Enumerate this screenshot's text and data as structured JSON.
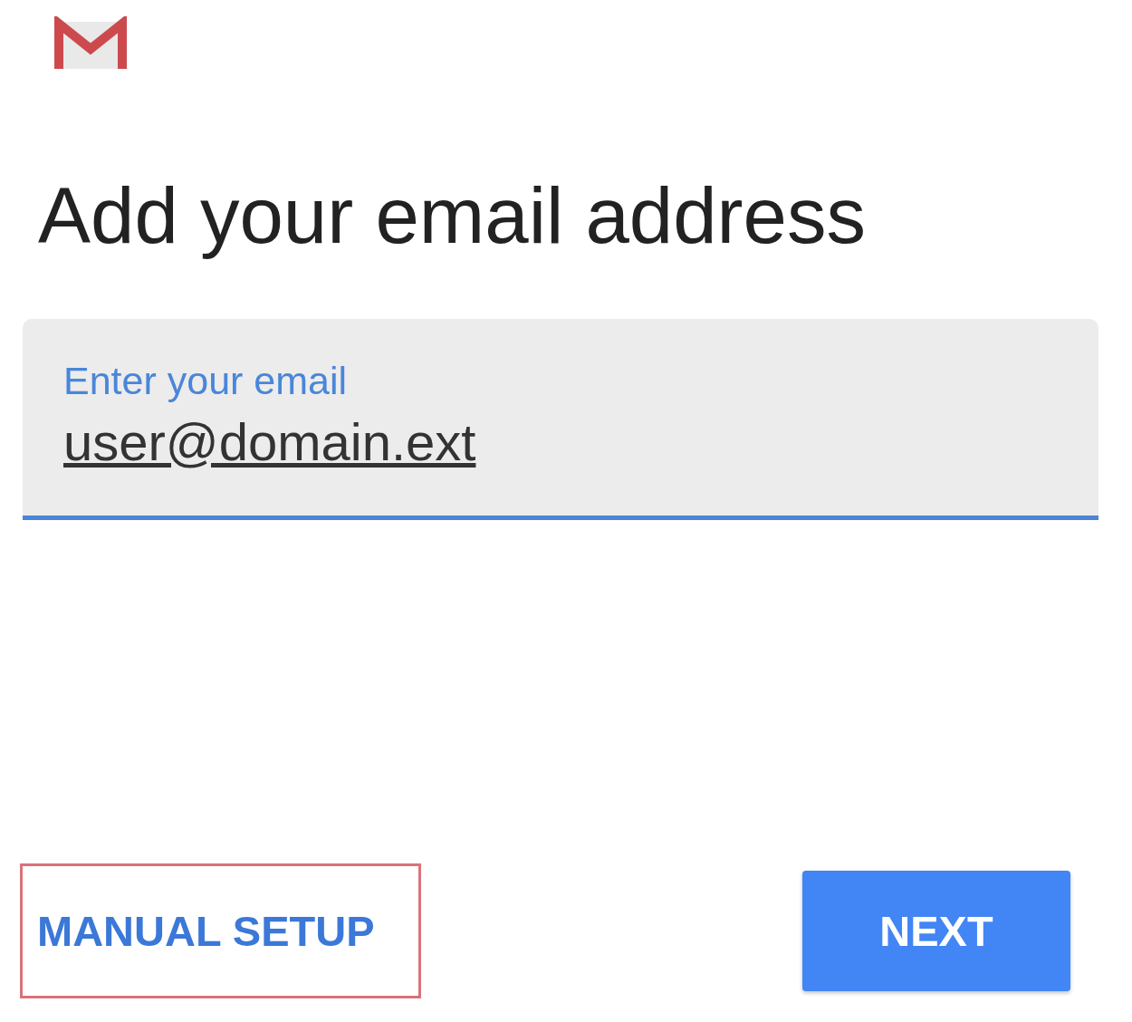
{
  "heading": "Add your email address",
  "email_field": {
    "label": "Enter your email",
    "value": "user@domain.ext",
    "focused": true
  },
  "buttons": [
    {
      "label": "MANUAL SETUP",
      "kind": "text",
      "highlighted": true
    },
    {
      "label": "NEXT",
      "kind": "filled",
      "highlighted": false
    }
  ]
}
